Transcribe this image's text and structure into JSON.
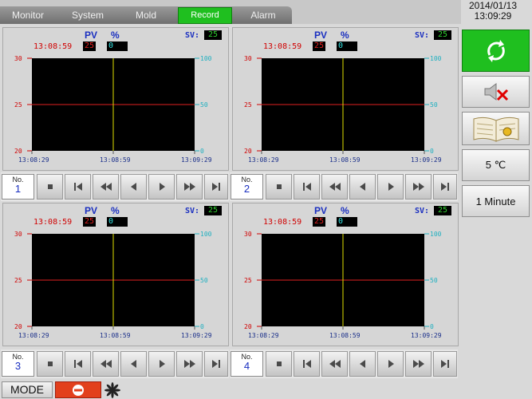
{
  "tabs": [
    {
      "label": "Monitor",
      "active": false
    },
    {
      "label": "System",
      "active": false
    },
    {
      "label": "Mold",
      "active": false
    },
    {
      "label": "Record",
      "active": true
    },
    {
      "label": "Alarm",
      "active": false
    }
  ],
  "datetime": {
    "date": "2014/01/13",
    "time": "13:09:29"
  },
  "panels": [
    {
      "pv_label": "PV",
      "pct_label": "%",
      "sv_label": "SV:",
      "sv_value": "25",
      "cursor_time": "13:08:59",
      "pv_value": "25",
      "pct_value": "0",
      "y_left": [
        "30",
        "25",
        "20"
      ],
      "y_right": [
        "100",
        "50",
        "0"
      ],
      "x_ticks": [
        "13:08:29",
        "13:08:59",
        "13:09:29"
      ],
      "no_label": "No.",
      "no_value": "1"
    },
    {
      "pv_label": "PV",
      "pct_label": "%",
      "sv_label": "SV:",
      "sv_value": "25",
      "cursor_time": "13:08:59",
      "pv_value": "25",
      "pct_value": "0",
      "y_left": [
        "30",
        "25",
        "20"
      ],
      "y_right": [
        "100",
        "50",
        "0"
      ],
      "x_ticks": [
        "13:08:29",
        "13:08:59",
        "13:09:29"
      ],
      "no_label": "No.",
      "no_value": "2"
    },
    {
      "pv_label": "PV",
      "pct_label": "%",
      "sv_label": "SV:",
      "sv_value": "25",
      "cursor_time": "13:08:59",
      "pv_value": "25",
      "pct_value": "0",
      "y_left": [
        "30",
        "25",
        "20"
      ],
      "y_right": [
        "100",
        "50",
        "0"
      ],
      "x_ticks": [
        "13:08:29",
        "13:08:59",
        "13:09:29"
      ],
      "no_label": "No.",
      "no_value": "3"
    },
    {
      "pv_label": "PV",
      "pct_label": "%",
      "sv_label": "SV:",
      "sv_value": "25",
      "cursor_time": "13:08:59",
      "pv_value": "25",
      "pct_value": "0",
      "y_left": [
        "30",
        "25",
        "20"
      ],
      "y_right": [
        "100",
        "50",
        "0"
      ],
      "x_ticks": [
        "13:08:29",
        "13:08:59",
        "13:09:29"
      ],
      "no_label": "No.",
      "no_value": "4"
    }
  ],
  "playback_buttons": [
    "stop-icon",
    "skip-start-icon",
    "fast-rewind-icon",
    "step-back-icon",
    "play-icon",
    "fast-forward-icon",
    "skip-end-icon"
  ],
  "right_panel": {
    "refresh_icon": "refresh-icon",
    "mute_icon": "speaker-mute-icon",
    "book_icon": "record-book-icon",
    "temp_scale": "5 ℃",
    "time_scale": "1 Minute"
  },
  "bottom": {
    "mode_label": "MODE",
    "stop_icon": "stop-sign-icon",
    "fan_icon": "fan-icon"
  },
  "colors": {
    "plot_bg": "#000000",
    "pv_line": "#e02020",
    "cursor_line": "#e0e000",
    "active_tab": "#1fbf1f",
    "left_axis": "#d00000",
    "right_axis": "#20b0c0",
    "stop_button": "#e2401c"
  }
}
